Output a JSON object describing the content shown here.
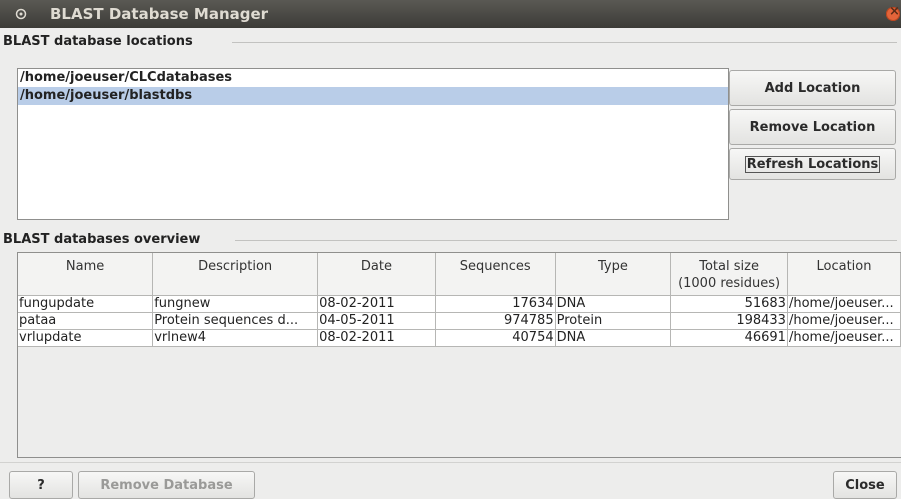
{
  "window": {
    "title": "BLAST Database Manager"
  },
  "locations_section": {
    "title": "BLAST database locations",
    "items": [
      {
        "path": "/home/joeuser/CLCdatabases",
        "selected": false
      },
      {
        "path": "/home/joeuser/blastdbs",
        "selected": true
      }
    ],
    "add_label": "Add Location",
    "remove_label": "Remove Location",
    "refresh_label": "Refresh Locations"
  },
  "overview_section": {
    "title": "BLAST databases overview",
    "columns": [
      "Name",
      "Description",
      "Date",
      "Sequences",
      "Type",
      "Total size\n(1000 residues)",
      "Location"
    ],
    "rows": [
      {
        "name": "fungupdate",
        "description": "fungnew",
        "date": "08-02-2011",
        "sequences": "17634",
        "type": "DNA",
        "total_size": "51683",
        "location": "/home/joeuser..."
      },
      {
        "name": "pataa",
        "description": "Protein sequences d...",
        "date": "04-05-2011",
        "sequences": "974785",
        "type": "Protein",
        "total_size": "198433",
        "location": "/home/joeuser..."
      },
      {
        "name": "vrlupdate",
        "description": "vrlnew4",
        "date": "08-02-2011",
        "sequences": "40754",
        "type": "DNA",
        "total_size": "46691",
        "location": "/home/joeuser..."
      }
    ]
  },
  "footer": {
    "help_label": "?",
    "remove_db_label": "Remove Database",
    "close_label": "Close"
  },
  "colors": {
    "selection": "#b9cde8",
    "titlebar": "#3c3b37",
    "close_button": "#e3643a"
  }
}
